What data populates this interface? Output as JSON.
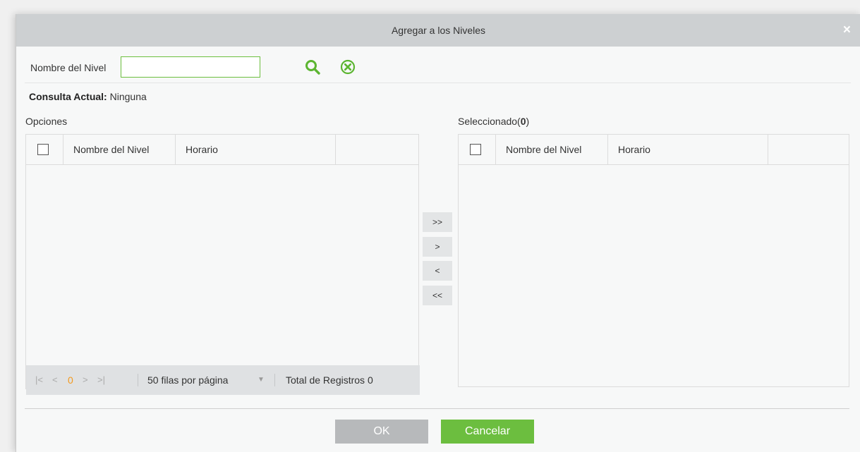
{
  "dialog": {
    "title": "Agregar a los Niveles",
    "close_glyph": "×"
  },
  "search": {
    "label": "Nombre del Nivel",
    "value": "",
    "placeholder": "",
    "search_icon": "search-icon",
    "clear_icon": "clear-circle-icon"
  },
  "query": {
    "label": "Consulta Actual:",
    "value": "Ninguna"
  },
  "options_panel": {
    "title": "Opciones",
    "columns": [
      "Nombre del Nivel",
      "Horario"
    ],
    "rows": [],
    "pager": {
      "first": "|<",
      "prev": "<",
      "current_page": "0",
      "next": ">",
      "last": ">|",
      "rows_per_page": "50 filas por página",
      "total": "Total de Registros 0"
    }
  },
  "selected_panel": {
    "title_prefix": "Seleccionado(",
    "count": "0",
    "title_suffix": ")",
    "columns": [
      "Nombre del Nivel",
      "Horario"
    ],
    "rows": []
  },
  "transfer": {
    "all_right": ">>",
    "right": ">",
    "left": "<",
    "all_left": "<<"
  },
  "footer": {
    "ok": "OK",
    "cancel": "Cancelar"
  },
  "colors": {
    "accent_green": "#6cbe3f",
    "page_orange": "#f39a1e",
    "disabled_gray": "#b7b9bb",
    "titlebar": "#cdd0d2"
  }
}
